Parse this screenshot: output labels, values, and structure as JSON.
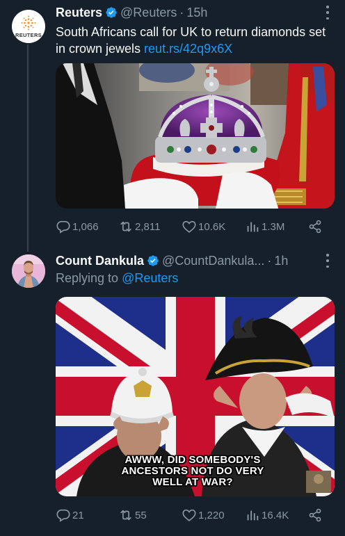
{
  "tweets": [
    {
      "author": {
        "name": "Reuters",
        "handle": "@Reuters",
        "logo_text": "REUTERS",
        "verified": true
      },
      "time": "15h",
      "dot": "·",
      "text": "South Africans call for UK to return diamonds set in crown jewels ",
      "link": "reut.rs/42q9x6X",
      "media": {
        "description_icon": "crown-photo"
      },
      "actions": {
        "replies": "1,066",
        "retweets": "2,811",
        "likes": "10.6K",
        "views": "1.3M"
      }
    },
    {
      "author": {
        "name": "Count Dankula",
        "handle": "@CountDankula...",
        "verified": true
      },
      "time": "1h",
      "dot": "·",
      "reply_prefix": "Replying to ",
      "reply_mention": "@Reuters",
      "media": {
        "caption_line1": "AWWW, DID SOMEBODY'S",
        "caption_line2": "ANCESTORS NOT DO VERY",
        "caption_line3": "WELL AT WAR?"
      },
      "actions": {
        "replies": "21",
        "retweets": "55",
        "likes": "1,220",
        "views": "16.4K"
      }
    }
  ],
  "colors": {
    "background": "#15202b",
    "text": "#f7f9f9",
    "secondary": "#8b98a5",
    "accent": "#1d9bf0"
  }
}
